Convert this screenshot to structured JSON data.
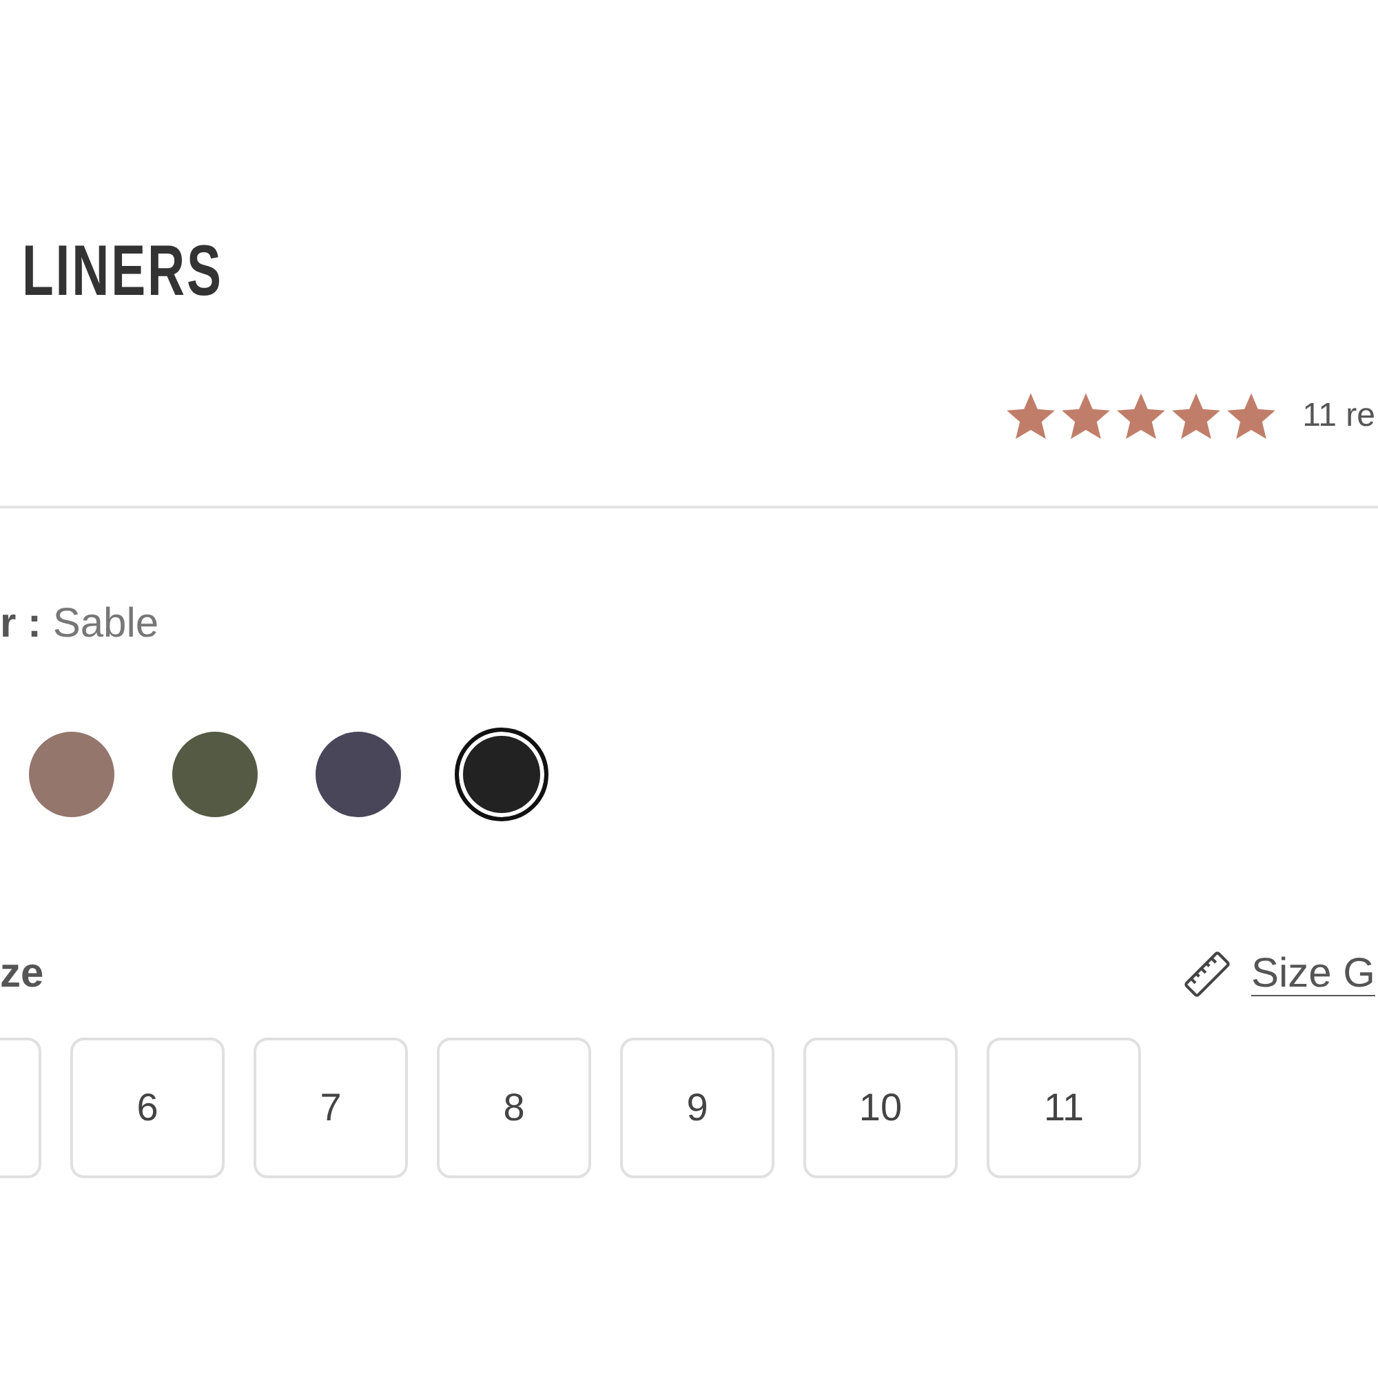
{
  "product": {
    "title": "LINERS"
  },
  "rating": {
    "stars": 5,
    "count": "11 re"
  },
  "color": {
    "label": "r :",
    "value": "Sable",
    "swatches": [
      {
        "color": "#94766c",
        "selected": false
      },
      {
        "color": "#555a44",
        "selected": false
      },
      {
        "color": "#49465a",
        "selected": false
      },
      {
        "color": "#222222",
        "selected": true
      }
    ]
  },
  "size": {
    "label": "ze",
    "guide_link": "Size G",
    "options": [
      {
        "label": "6",
        "selected": false
      },
      {
        "label": "7",
        "selected": false
      },
      {
        "label": "8",
        "selected": false
      },
      {
        "label": "9",
        "selected": false
      },
      {
        "label": "10",
        "selected": false
      },
      {
        "label": "11",
        "selected": false
      }
    ]
  }
}
